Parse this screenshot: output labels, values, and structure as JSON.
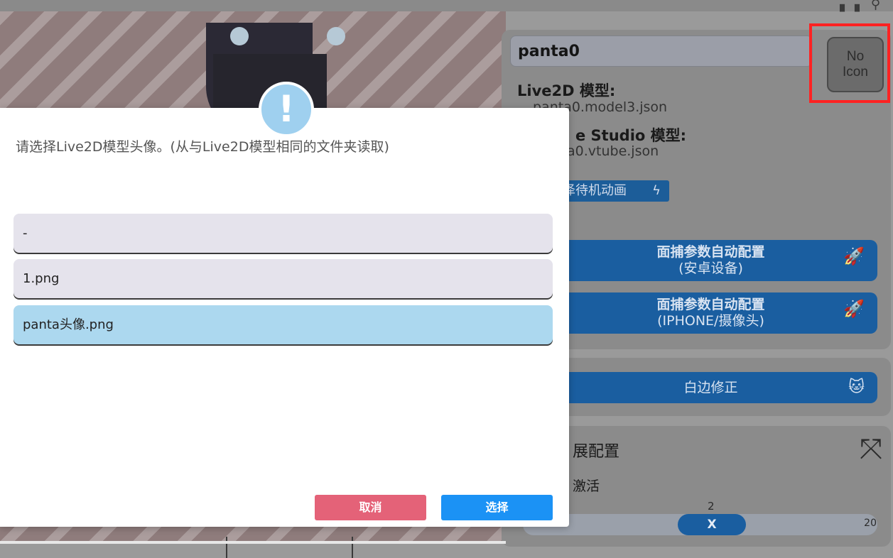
{
  "dialog": {
    "message": "请选择Live2D模型头像。(从与Live2D模型相同的文件夹读取)",
    "alert_glyph": "!",
    "options": [
      {
        "label": "-",
        "selected": false
      },
      {
        "label": "1.png",
        "selected": false
      },
      {
        "label": "panta头像.png",
        "selected": true
      }
    ],
    "cancel_label": "取消",
    "select_label": "选择",
    "colors": {
      "cancel": "#e46278",
      "select": "#1b92f5",
      "selected_option": "#acd8ef"
    }
  },
  "panel": {
    "model_name": "panta0",
    "icon_placeholder_line1": "No",
    "icon_placeholder_line2": "Icon",
    "live2d_label": "Live2D 模型:",
    "live2d_file": "panta0.model3.json",
    "vts_label": "e Studio 模型:",
    "vts_file": "a0.vtube.json",
    "idle_anim_label": "泽待机动画",
    "face_auto_android_line1": "面捕参数自动配置",
    "face_auto_android_line2": "(安卓设备)",
    "face_auto_iphone_line1": "面捕参数自动配置",
    "face_auto_iphone_line2": "(IPHONE/摄像头)",
    "white_edge_label": "白边修正",
    "extension_title": "展配置",
    "activate_label": "激活",
    "slider_value": "2",
    "slider_knob_label": "X",
    "slider_max": "20"
  },
  "icons": [
    "alert-icon",
    "bolt-icon",
    "rocket-icon",
    "cat-icon",
    "axes-person-icon"
  ]
}
